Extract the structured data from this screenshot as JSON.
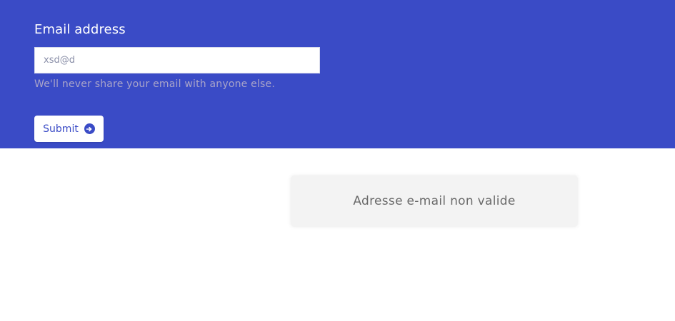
{
  "form": {
    "email_label": "Email address",
    "email_value": "xsd@d",
    "help_text": "We'll never share your email with anyone else.",
    "submit_label": "Submit",
    "submit_icon": "arrow-right-circle-icon"
  },
  "alert": {
    "message": "Adresse e-mail non valide"
  },
  "colors": {
    "hero_background": "#3a4bc6",
    "button_text": "#3a4bc6",
    "alert_background": "#f3f3f3"
  }
}
